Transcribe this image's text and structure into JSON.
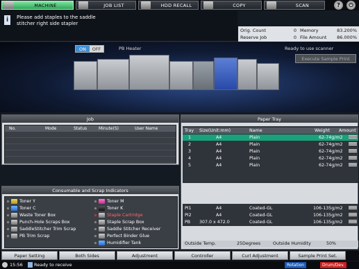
{
  "tabs": [
    {
      "label": "MACHINE",
      "icon": "machine-icon",
      "active": true
    },
    {
      "label": "JOB LIST",
      "icon": "job-list-icon"
    },
    {
      "label": "HDD RECALL",
      "icon": "hdd-icon"
    },
    {
      "label": "COPY",
      "icon": "copy-icon"
    },
    {
      "label": "SCAN",
      "icon": "scan-icon"
    }
  ],
  "top_buttons": [
    "help-icon",
    "power-icon"
  ],
  "message": {
    "text": "Please add staples to the saddle\nstitcher right side stapler"
  },
  "status": {
    "orig_count_label": "Orig. Count",
    "orig_count": "0",
    "memory_label": "Memory",
    "memory": "83.200%",
    "reserve_job_label": "Reserve Job",
    "reserve_job": "0",
    "file_amount_label": "File Amount",
    "file_amount": "86.000%"
  },
  "machine": {
    "on_label": "ON",
    "off_label": "OFF",
    "pb_heater": "PB Heater",
    "ready": "Ready to use scanner",
    "sample_print": "Execute Sample Print"
  },
  "job": {
    "title": "Job",
    "columns": [
      "No.",
      "Mode",
      "Status",
      "Minute(S)",
      "User Name"
    ]
  },
  "consumables": {
    "title": "Consumable and Scrap Indicators",
    "items_left": [
      {
        "label": "Toner Y",
        "icon": "toner-icon"
      },
      {
        "label": "Toner C",
        "icon": "toner-icon"
      },
      {
        "label": "Waste Toner Box",
        "icon": "box-icon"
      },
      {
        "label": "Punch-Hole Scraps Box",
        "icon": "box-icon"
      },
      {
        "label": "SaddleStitcher Trim Scrap",
        "icon": "box-icon"
      },
      {
        "label": "PB Trim Scrap",
        "icon": "box-icon"
      }
    ],
    "items_right": [
      {
        "label": "Toner M",
        "icon": "toner-icon"
      },
      {
        "label": "Toner K",
        "icon": "toner-icon"
      },
      {
        "label": "Staple Cartridge",
        "icon": "staple-icon",
        "alert": true
      },
      {
        "label": "Staple Scrap Box",
        "icon": "box-icon"
      },
      {
        "label": "Saddle Stitcher Receiver",
        "icon": "box-icon"
      },
      {
        "label": "Perfect Binder Glue",
        "icon": "glue-icon"
      },
      {
        "label": "Humidifier Tank",
        "icon": "tank-icon"
      }
    ]
  },
  "paper_tray": {
    "title": "Paper Tray",
    "columns": [
      "Tray",
      "Size(Unit:mm)",
      "Name",
      "Weight",
      "Amount"
    ],
    "rows": [
      {
        "tray": "1",
        "size": "A4",
        "name": "Plain",
        "weight": "62-74g/m2",
        "selected": true
      },
      {
        "tray": "2",
        "size": "A4",
        "name": "Plain",
        "weight": "62-74g/m2"
      },
      {
        "tray": "3",
        "size": "A4",
        "name": "Plain",
        "weight": "62-74g/m2"
      },
      {
        "tray": "4",
        "size": "A4",
        "name": "Plain",
        "weight": "62-74g/m2"
      },
      {
        "tray": "5",
        "size": "A4",
        "name": "Plain",
        "weight": "62-74g/m2"
      }
    ],
    "rows2": [
      {
        "tray": "PI1",
        "size": "A4",
        "name": "Coated-GL",
        "weight": "106-135g/m2"
      },
      {
        "tray": "PI2",
        "size": "A4",
        "name": "Coated-GL",
        "weight": "106-135g/m2"
      },
      {
        "tray": "PB",
        "size": "307.0 x 472.0",
        "name": "Coated-GL",
        "weight": "106-135g/m2"
      }
    ],
    "outside_temp_label": "Outside Temp.",
    "outside_temp": "25Degrees",
    "outside_hum_label": "Outside Humidity",
    "outside_hum": "50%"
  },
  "bottom": [
    "Paper Setting",
    "Both Sides",
    "Adjustment",
    "Controller",
    "Curl Adjustment",
    "Sample Print Set."
  ],
  "statusbar": {
    "time": "15:56",
    "text": "Ready to receive",
    "rotation": "Rotation",
    "drum": "Drum/Dev."
  },
  "colors": {
    "active_tab": "#2fa457",
    "selected_row": "#1aa07a",
    "alert": "#e22"
  }
}
